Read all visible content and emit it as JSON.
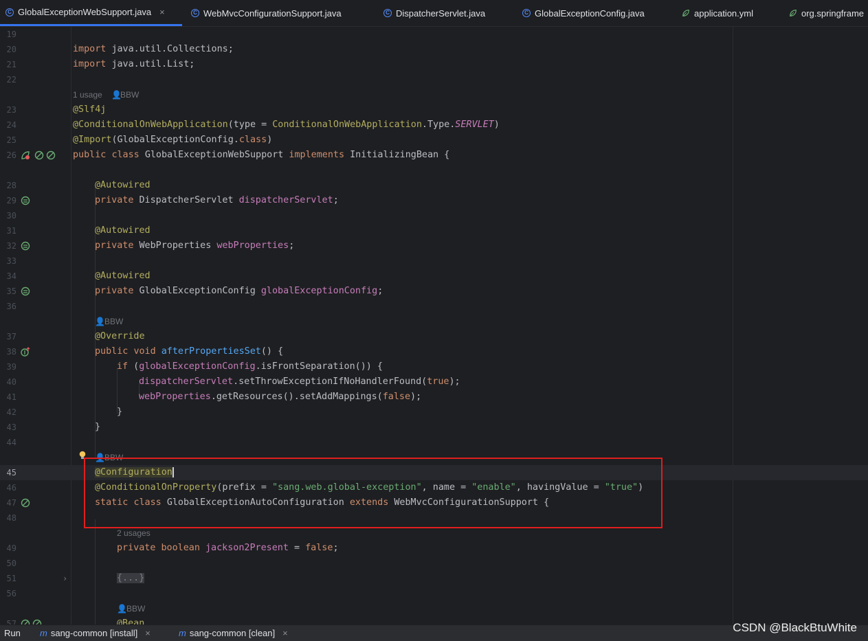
{
  "tabs": [
    {
      "label": "GlobalExceptionWebSupport.java",
      "icon": "class-icon",
      "active": true
    },
    {
      "label": "WebMvcConfigurationSupport.java",
      "icon": "class-icon"
    },
    {
      "label": "DispatcherServlet.java",
      "icon": "class-icon"
    },
    {
      "label": "GlobalExceptionConfig.java",
      "icon": "class-icon"
    },
    {
      "label": "application.yml",
      "icon": "yaml-leaf-icon"
    },
    {
      "label": "org.springframe",
      "icon": "leaf-icon"
    }
  ],
  "tab_close_glyph": "×",
  "line_numbers": {
    "l19": "19",
    "l20": "20",
    "l21": "21",
    "l22": "22",
    "l23": "23",
    "l24": "24",
    "l25": "25",
    "l26": "26",
    "l28": "28",
    "l29": "29",
    "l30": "30",
    "l31": "31",
    "l32": "32",
    "l33": "33",
    "l34": "34",
    "l35": "35",
    "l36": "36",
    "l37": "37",
    "l38": "38",
    "l39": "39",
    "l40": "40",
    "l41": "41",
    "l42": "42",
    "l43": "43",
    "l44": "44",
    "l45": "45",
    "l46": "46",
    "l47": "47",
    "l48": "48",
    "l49": "49",
    "l50": "50",
    "l51": "51",
    "l56": "56",
    "l57": "57"
  },
  "inlay_hints": {
    "usages_1": "1 usage",
    "author_1": "BBW",
    "author_2": "BBW",
    "author_3": "BBW",
    "usages_2": "2 usages",
    "author_4": "BBW"
  },
  "code": {
    "import_kw": "import",
    "import1": "java.util.Collections;",
    "import2": "java.util.List;",
    "slf4j": "@Slf4j",
    "cond_web_ann": "@ConditionalOnWebApplication",
    "cond_web_open": "(type = ",
    "cond_web_cls": "ConditionalOnWebApplication",
    "cond_web_type": ".Type.",
    "servlet": "SERVLET",
    "close_paren": ")",
    "import_ann": "@Import",
    "import_arg": "(GlobalExceptionConfig.",
    "class_kw": "class",
    "public_kw": "public",
    "class_name": "GlobalExceptionWebSupport",
    "implements_kw": "implements",
    "initializing_bean": "InitializingBean {",
    "autowired": "@Autowired",
    "private_kw": "private",
    "dispatcher_type": "DispatcherServlet",
    "dispatcher_field": "dispatcherServlet",
    "semicolon": ";",
    "webprops_type": "WebProperties",
    "webprops_field": "webProperties",
    "gec_type": "GlobalExceptionConfig",
    "gec_field": "globalExceptionConfig",
    "override": "@Override",
    "void_kw": "void",
    "after_props": "afterPropertiesSet",
    "after_props_rest": "() {",
    "if_kw": "if",
    "if_open": " (",
    "is_front": ".isFrontSeparation()) {",
    "set_throw": ".setThrowExceptionIfNoHandlerFound(",
    "true_kw": "true",
    "close_semi": ");",
    "get_res": ".getResources().setAddMappings(",
    "false_kw": "false",
    "close_brace": "}",
    "configuration": "@Configuration",
    "cond_prop": "@ConditionalOnProperty",
    "prefix_open": "(prefix = ",
    "prefix_val": "\"sang.web.global-exception\"",
    "name_eq": ", name = ",
    "name_val": "\"enable\"",
    "having_eq": ", havingValue = ",
    "having_val": "\"true\"",
    "static_kw": "static",
    "auto_cfg": "GlobalExceptionAutoConfiguration",
    "extends_kw": "extends",
    "wmcs": "WebMvcConfigurationSupport {",
    "boolean_kw": "boolean",
    "jackson": "jackson2Present",
    "eq": " = ",
    "folded": "{...}",
    "bean": "@Bean"
  },
  "bottom_bar": {
    "run_label": "Run",
    "tab1": "sang-common [install]",
    "tab2": "sang-common [clean]",
    "close_glyph": "×"
  },
  "watermark": "CSDN @BlackBtuWhite",
  "colors": {
    "background": "#1e1f22",
    "keyword": "#cf8e6d",
    "annotation": "#b3ae60",
    "field": "#c77dbb",
    "method": "#56a8f5",
    "string": "#6aab73",
    "highlight_box": "#e11e1e",
    "active_tab_underline": "#3574f0"
  }
}
